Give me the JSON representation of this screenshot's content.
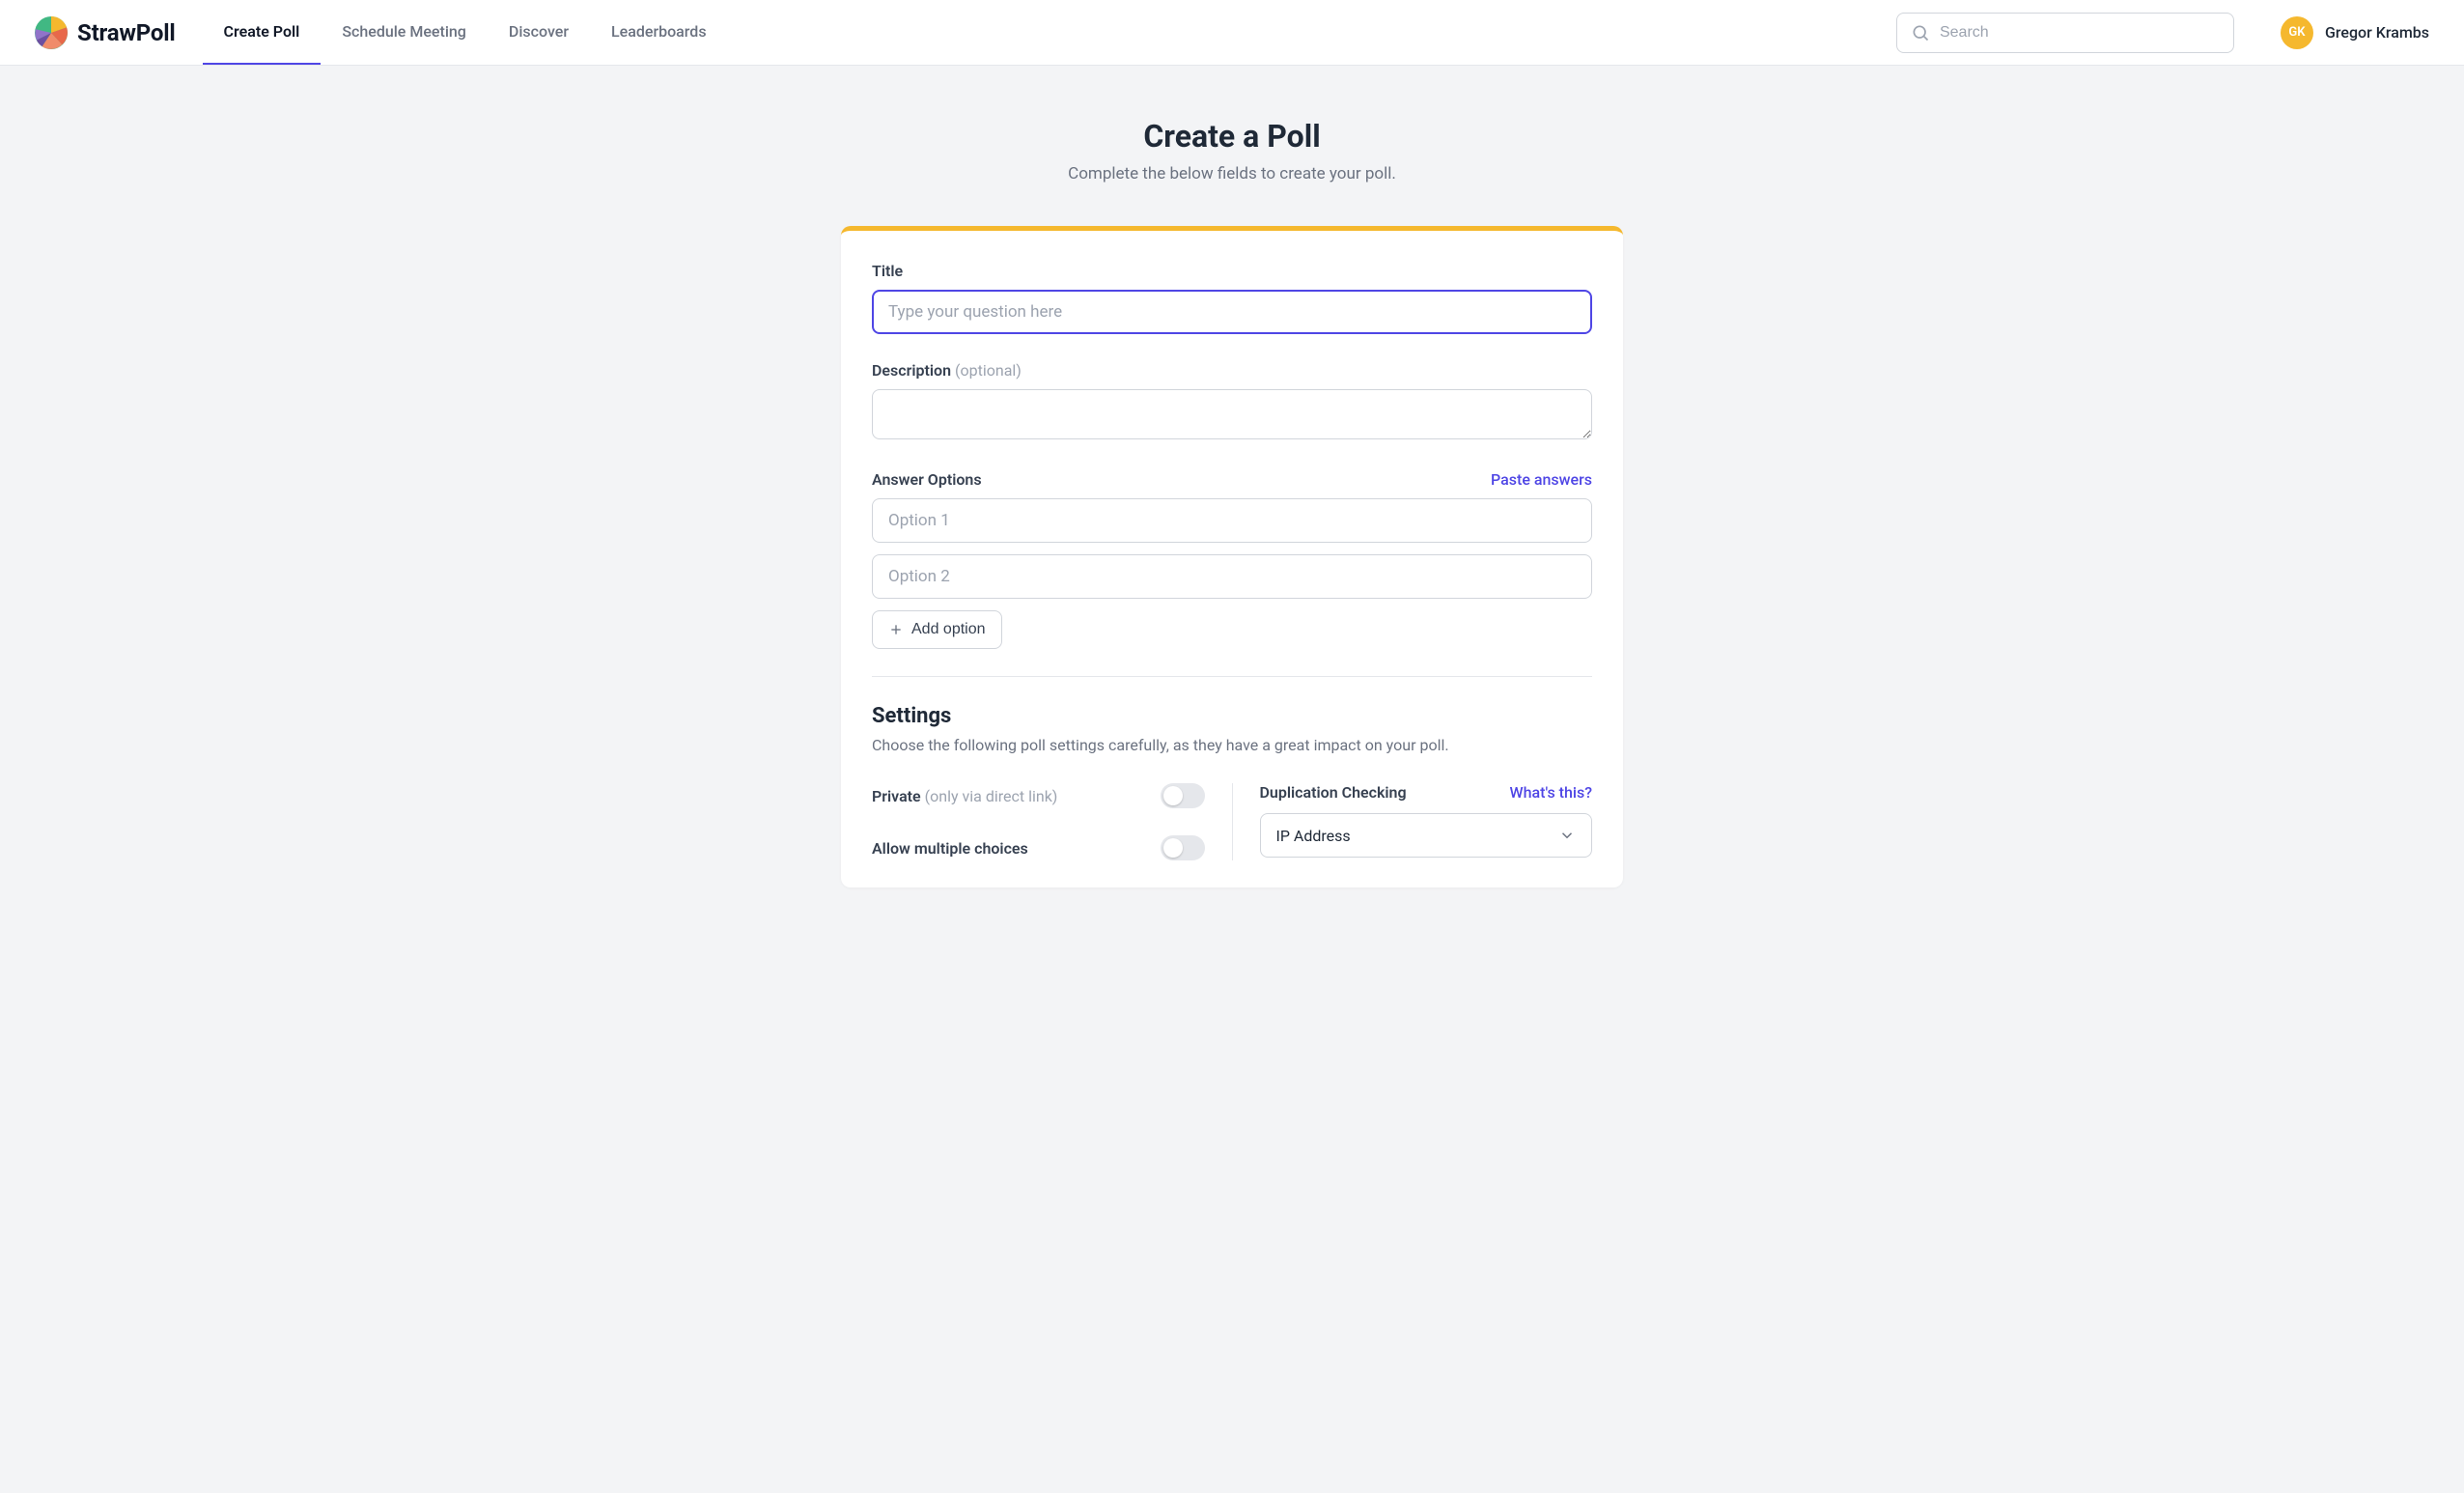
{
  "brand": "StrawPoll",
  "nav": {
    "items": [
      {
        "label": "Create Poll",
        "active": true
      },
      {
        "label": "Schedule Meeting",
        "active": false
      },
      {
        "label": "Discover",
        "active": false
      },
      {
        "label": "Leaderboards",
        "active": false
      }
    ]
  },
  "search": {
    "placeholder": "Search"
  },
  "user": {
    "initials": "GK",
    "name": "Gregor Krambs"
  },
  "page": {
    "title": "Create a Poll",
    "subtitle": "Complete the below fields to create your poll."
  },
  "form": {
    "title_label": "Title",
    "title_placeholder": "Type your question here",
    "description_label": "Description",
    "description_hint": "(optional)",
    "options_label": "Answer Options",
    "paste_label": "Paste answers",
    "option_placeholders": [
      "Option 1",
      "Option 2"
    ],
    "add_option_label": "Add option"
  },
  "settings": {
    "heading": "Settings",
    "sub": "Choose the following poll settings carefully, as they have a great impact on your poll.",
    "private_label": "Private",
    "private_hint": "(only via direct link)",
    "multiple_label": "Allow multiple choices",
    "dup_label": "Duplication Checking",
    "whats_this": "What's this?",
    "dup_value": "IP Address"
  },
  "colors": {
    "accent": "#4f46e5",
    "brand_yellow": "#f5b82e"
  }
}
